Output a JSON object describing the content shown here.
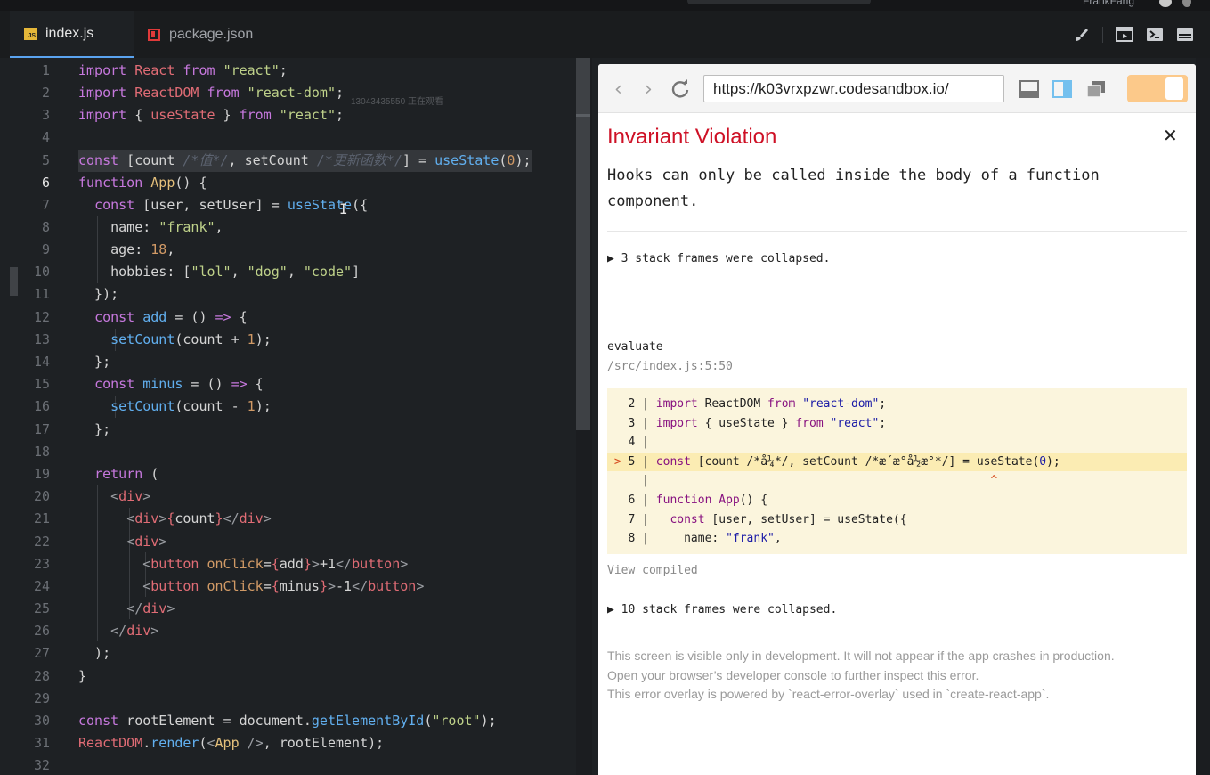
{
  "topbar": {
    "user_name": "FrankFang"
  },
  "tabs": [
    {
      "label": "index.js",
      "icon": "js-file-icon",
      "active": true
    },
    {
      "label": "package.json",
      "icon": "package-icon",
      "active": false
    }
  ],
  "toolbar_icons": [
    "brush-icon",
    "preview-icon",
    "terminal-icon",
    "console-icon"
  ],
  "editor": {
    "watermark": "13043435550 正在观看",
    "line_numbers": [
      "1",
      "2",
      "3",
      "4",
      "5",
      "6",
      "7",
      "8",
      "9",
      "10",
      "11",
      "12",
      "13",
      "14",
      "15",
      "16",
      "17",
      "18",
      "19",
      "20",
      "21",
      "22",
      "23",
      "24",
      "25",
      "26",
      "27",
      "28",
      "29",
      "30",
      "31",
      "32"
    ]
  },
  "browser": {
    "url": "https://k03vrxpzwr.codesandbox.io/",
    "icons": [
      "back-icon",
      "forward-icon",
      "refresh-icon",
      "layout-bottom-icon",
      "layout-right-icon",
      "open-window-icon"
    ]
  },
  "overlay": {
    "title": "Invariant Violation",
    "message": "Hooks can only be called inside the body of a function component.",
    "collapsed_1": "▶ 3 stack frames were collapsed.",
    "frame_fn": "evaluate",
    "frame_path": "/src/index.js:5:50",
    "view_compiled": "View compiled",
    "collapsed_2": "▶ 10 stack frames were collapsed.",
    "footer": [
      "This screen is visible only in development. It will not appear if the app crashes in production.",
      "Open your browser’s developer console to further inspect this error.",
      "This error overlay is powered by `react-error-overlay` used in `create-react-app`."
    ]
  },
  "colors": {
    "accent": "#5aa3f0",
    "error": "#ce1126",
    "toggle": "#fcc98a"
  }
}
